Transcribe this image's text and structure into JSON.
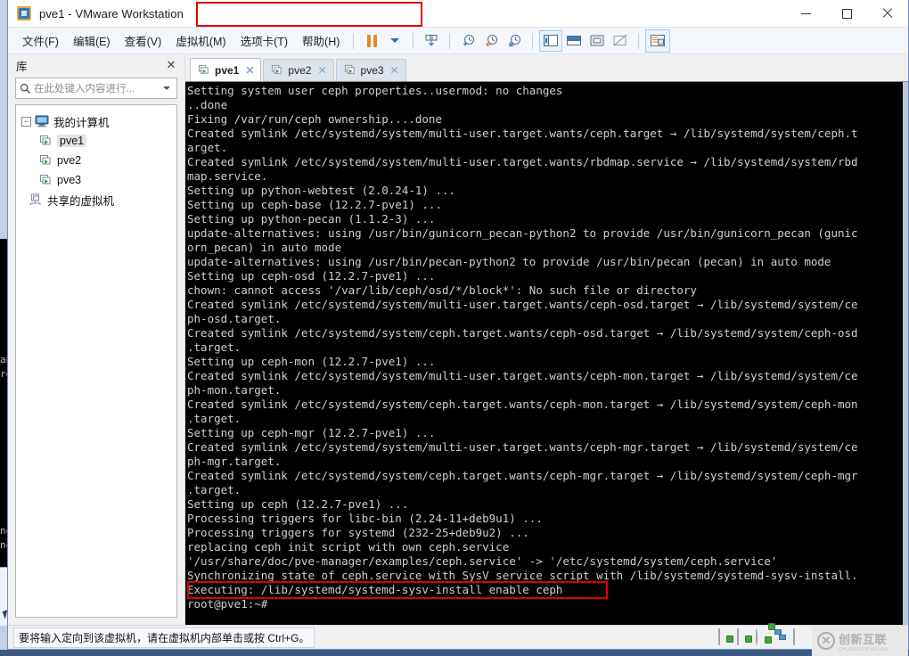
{
  "window": {
    "title": "pve1 - VMware Workstation",
    "app_icon": "vmware-icon",
    "minimize_label": "—",
    "maximize_label": "☐",
    "close_label": "✕"
  },
  "menubar": {
    "items": [
      {
        "label": "文件(F)",
        "name": "menu-file"
      },
      {
        "label": "编辑(E)",
        "name": "menu-edit"
      },
      {
        "label": "查看(V)",
        "name": "menu-view"
      },
      {
        "label": "虚拟机(M)",
        "name": "menu-vm"
      },
      {
        "label": "选项卡(T)",
        "name": "menu-tabs"
      },
      {
        "label": "帮助(H)",
        "name": "menu-help"
      }
    ],
    "toolbar": [
      {
        "name": "pause-icon",
        "title": "暂停"
      },
      {
        "name": "chevron-down-icon",
        "title": "更多"
      },
      {
        "name": "snapshot-icon",
        "title": "快照"
      },
      {
        "name": "take-snapshot-icon",
        "title": "创建快照"
      },
      {
        "name": "revert-snapshot-icon",
        "title": "恢复快照"
      },
      {
        "name": "snapshot-manager-icon",
        "title": "快照管理器"
      },
      {
        "name": "show-library-icon",
        "title": "显示或隐藏库"
      },
      {
        "name": "console-view-icon",
        "title": "控制台视图"
      },
      {
        "name": "fullscreen-icon",
        "title": "全屏"
      },
      {
        "name": "unity-icon",
        "title": "Unity"
      },
      {
        "name": "thumbnail-view-icon",
        "title": "缩略图"
      }
    ]
  },
  "sidebar": {
    "title": "库",
    "close_label": "✕",
    "search": {
      "placeholder": "在此处键入内容进行...",
      "value": ""
    },
    "tree": [
      {
        "label": "我的计算机",
        "icon": "my-computer-icon",
        "level": 0,
        "expander": "-",
        "selected": false
      },
      {
        "label": "pve1",
        "icon": "vm-powered-on-icon",
        "level": 1,
        "selected": true
      },
      {
        "label": "pve2",
        "icon": "vm-powered-on-icon",
        "level": 1,
        "selected": false
      },
      {
        "label": "pve3",
        "icon": "vm-powered-on-icon",
        "level": 1,
        "selected": false
      },
      {
        "label": "共享的虚拟机",
        "icon": "shared-vms-icon",
        "level": 0,
        "selected": false
      }
    ]
  },
  "tabs": {
    "items": [
      {
        "label": "pve1",
        "active": true,
        "close_label": "✕"
      },
      {
        "label": "pve2",
        "active": false,
        "close_label": "✕"
      },
      {
        "label": "pve3",
        "active": false,
        "close_label": "✕"
      }
    ],
    "annotation_color": "#e00000"
  },
  "terminal": {
    "lines": [
      "Setting system user ceph properties..usermod: no changes",
      "..done",
      "Fixing /var/run/ceph ownership....done",
      "Created symlink /etc/systemd/system/multi-user.target.wants/ceph.target → /lib/systemd/system/ceph.t",
      "arget.",
      "Created symlink /etc/systemd/system/multi-user.target.wants/rbdmap.service → /lib/systemd/system/rbd",
      "map.service.",
      "Setting up python-webtest (2.0.24-1) ...",
      "Setting up ceph-base (12.2.7-pve1) ...",
      "Setting up python-pecan (1.1.2-3) ...",
      "update-alternatives: using /usr/bin/gunicorn_pecan-python2 to provide /usr/bin/gunicorn_pecan (gunic",
      "orn_pecan) in auto mode",
      "update-alternatives: using /usr/bin/pecan-python2 to provide /usr/bin/pecan (pecan) in auto mode",
      "Setting up ceph-osd (12.2.7-pve1) ...",
      "chown: cannot access '/var/lib/ceph/osd/*/block*': No such file or directory",
      "Created symlink /etc/systemd/system/multi-user.target.wants/ceph-osd.target → /lib/systemd/system/ce",
      "ph-osd.target.",
      "Created symlink /etc/systemd/system/ceph.target.wants/ceph-osd.target → /lib/systemd/system/ceph-osd",
      ".target.",
      "Setting up ceph-mon (12.2.7-pve1) ...",
      "Created symlink /etc/systemd/system/multi-user.target.wants/ceph-mon.target → /lib/systemd/system/ce",
      "ph-mon.target.",
      "Created symlink /etc/systemd/system/ceph.target.wants/ceph-mon.target → /lib/systemd/system/ceph-mon",
      ".target.",
      "Setting up ceph-mgr (12.2.7-pve1) ...",
      "Created symlink /etc/systemd/system/multi-user.target.wants/ceph-mgr.target → /lib/systemd/system/ce",
      "ph-mgr.target.",
      "Created symlink /etc/systemd/system/ceph.target.wants/ceph-mgr.target → /lib/systemd/system/ceph-mgr",
      ".target.",
      "Setting up ceph (12.2.7-pve1) ...",
      "Processing triggers for libc-bin (2.24-11+deb9u1) ...",
      "Processing triggers for systemd (232-25+deb9u2) ...",
      "replacing ceph init script with own ceph.service",
      "'/usr/share/doc/pve-manager/examples/ceph.service' -> '/etc/systemd/system/ceph.service'",
      "Synchronizing state of ceph.service with SysV service script with /lib/systemd/systemd-sysv-install.",
      "Executing: /lib/systemd/systemd-sysv-install enable ceph",
      "root@pve1:~#"
    ],
    "highlight_line": "Executing: /lib/systemd/systemd-sysv-install enable ceph",
    "annotation_color": "#e00000",
    "background": "#000000",
    "foreground": "#cfcfcf"
  },
  "statusbar": {
    "message": "要将输入定向到该虚拟机，请在虚拟机内部单击或按 Ctrl+G。",
    "devices": [
      {
        "name": "hard-disk-icon"
      },
      {
        "name": "hard-disk-icon"
      },
      {
        "name": "cd-dvd-icon"
      },
      {
        "name": "network-adapter-icon"
      },
      {
        "name": "printer-icon"
      }
    ]
  },
  "watermark": {
    "logo": "✕",
    "main": "创新互联",
    "sub": "CHUANGXIN HULIAN"
  },
  "background_window": {
    "text_fragments": [
      "an",
      "re",
      "no",
      "no"
    ]
  }
}
